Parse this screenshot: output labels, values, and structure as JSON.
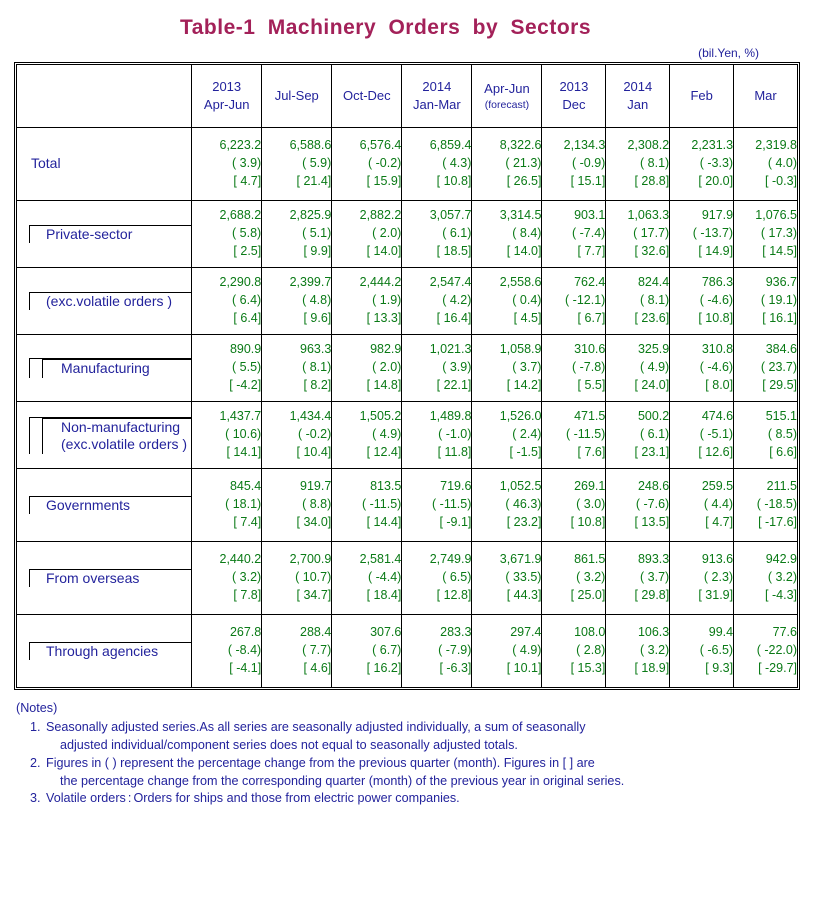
{
  "title": "Table-1  Machinery  Orders  by  Sectors",
  "unit_note": "(bil.Yen, %)",
  "columns": [
    {
      "year": "2013",
      "period": "Apr-Jun",
      "forecast": ""
    },
    {
      "year": "",
      "period": "Jul-Sep",
      "forecast": ""
    },
    {
      "year": "",
      "period": "Oct-Dec",
      "forecast": ""
    },
    {
      "year": "2014",
      "period": "Jan-Mar",
      "forecast": ""
    },
    {
      "year": "",
      "period": "Apr-Jun",
      "forecast": "(forecast)"
    },
    {
      "year": "2013",
      "period": "Dec",
      "forecast": ""
    },
    {
      "year": "2014",
      "period": "Jan",
      "forecast": ""
    },
    {
      "year": "",
      "period": "Feb",
      "forecast": ""
    },
    {
      "year": "",
      "period": "Mar",
      "forecast": ""
    }
  ],
  "rows": [
    {
      "id": "total",
      "label": "Total",
      "label2": "",
      "level": 0,
      "values": [
        [
          "6,223.2",
          "( 3.9)",
          "[ 4.7]"
        ],
        [
          "6,588.6",
          "( 5.9)",
          "[ 21.4]"
        ],
        [
          "6,576.4",
          "( -0.2)",
          "[ 15.9]"
        ],
        [
          "6,859.4",
          "( 4.3)",
          "[ 10.8]"
        ],
        [
          "8,322.6",
          "( 21.3)",
          "[ 26.5]"
        ],
        [
          "2,134.3",
          "( -0.9)",
          "[ 15.1]"
        ],
        [
          "2,308.2",
          "( 8.1)",
          "[ 28.8]"
        ],
        [
          "2,231.3",
          "( -3.3)",
          "[ 20.0]"
        ],
        [
          "2,319.8",
          "( 4.0)",
          "[ -0.3]"
        ]
      ]
    },
    {
      "id": "private-sector",
      "label": "Private-sector",
      "label2": "",
      "level": 1,
      "values": [
        [
          "2,688.2",
          "( 5.8)",
          "[ 2.5]"
        ],
        [
          "2,825.9",
          "( 5.1)",
          "[ 9.9]"
        ],
        [
          "2,882.2",
          "( 2.0)",
          "[ 14.0]"
        ],
        [
          "3,057.7",
          "( 6.1)",
          "[ 18.5]"
        ],
        [
          "3,314.5",
          "( 8.4)",
          "[ 14.0]"
        ],
        [
          "903.1",
          "( -7.4)",
          "[ 7.7]"
        ],
        [
          "1,063.3",
          "( 17.7)",
          "[ 32.6]"
        ],
        [
          "917.9",
          "( -13.7)",
          "[ 14.9]"
        ],
        [
          "1,076.5",
          "( 17.3)",
          "[ 14.5]"
        ]
      ]
    },
    {
      "id": "private-sector-exc-volatile",
      "label": "(exc.volatile orders )",
      "label2": "",
      "level": 1,
      "values": [
        [
          "2,290.8",
          "( 6.4)",
          "[ 6.4]"
        ],
        [
          "2,399.7",
          "( 4.8)",
          "[ 9.6]"
        ],
        [
          "2,444.2",
          "( 1.9)",
          "[ 13.3]"
        ],
        [
          "2,547.4",
          "( 4.2)",
          "[ 16.4]"
        ],
        [
          "2,558.6",
          "( 0.4)",
          "[ 4.5]"
        ],
        [
          "762.4",
          "( -12.1)",
          "[ 6.7]"
        ],
        [
          "824.4",
          "( 8.1)",
          "[ 23.6]"
        ],
        [
          "786.3",
          "( -4.6)",
          "[ 10.8]"
        ],
        [
          "936.7",
          "( 19.1)",
          "[ 16.1]"
        ]
      ]
    },
    {
      "id": "manufacturing",
      "label": "Manufacturing",
      "label2": "",
      "level": 2,
      "values": [
        [
          "890.9",
          "( 5.5)",
          "[ -4.2]"
        ],
        [
          "963.3",
          "( 8.1)",
          "[ 8.2]"
        ],
        [
          "982.9",
          "( 2.0)",
          "[ 14.8]"
        ],
        [
          "1,021.3",
          "( 3.9)",
          "[ 22.1]"
        ],
        [
          "1,058.9",
          "( 3.7)",
          "[ 14.2]"
        ],
        [
          "310.6",
          "( -7.8)",
          "[ 5.5]"
        ],
        [
          "325.9",
          "( 4.9)",
          "[ 24.0]"
        ],
        [
          "310.8",
          "( -4.6)",
          "[ 8.0]"
        ],
        [
          "384.6",
          "( 23.7)",
          "[ 29.5]"
        ]
      ]
    },
    {
      "id": "non-manufacturing",
      "label": "Non-manufacturing",
      "label2": "(exc.volatile orders )",
      "level": 2,
      "values": [
        [
          "1,437.7",
          "( 10.6)",
          "[ 14.1]"
        ],
        [
          "1,434.4",
          "( -0.2)",
          "[ 10.4]"
        ],
        [
          "1,505.2",
          "( 4.9)",
          "[ 12.4]"
        ],
        [
          "1,489.8",
          "( -1.0)",
          "[ 11.8]"
        ],
        [
          "1,526.0",
          "( 2.4)",
          "[ -1.5]"
        ],
        [
          "471.5",
          "( -11.5)",
          "[ 7.6]"
        ],
        [
          "500.2",
          "( 6.1)",
          "[ 23.1]"
        ],
        [
          "474.6",
          "( -5.1)",
          "[ 12.6]"
        ],
        [
          "515.1",
          "( 8.5)",
          "[ 6.6]"
        ]
      ]
    },
    {
      "id": "governments",
      "label": "Governments",
      "label2": "",
      "level": 1,
      "values": [
        [
          "845.4",
          "( 18.1)",
          "[ 7.4]"
        ],
        [
          "919.7",
          "( 8.8)",
          "[ 34.0]"
        ],
        [
          "813.5",
          "( -11.5)",
          "[ 14.4]"
        ],
        [
          "719.6",
          "( -11.5)",
          "[ -9.1]"
        ],
        [
          "1,052.5",
          "( 46.3)",
          "[ 23.2]"
        ],
        [
          "269.1",
          "( 3.0)",
          "[ 10.8]"
        ],
        [
          "248.6",
          "( -7.6)",
          "[ 13.5]"
        ],
        [
          "259.5",
          "( 4.4)",
          "[ 4.7]"
        ],
        [
          "211.5",
          "( -18.5)",
          "[ -17.6]"
        ]
      ]
    },
    {
      "id": "from-overseas",
      "label": "From overseas",
      "label2": "",
      "level": 1,
      "values": [
        [
          "2,440.2",
          "( 3.2)",
          "[ 7.8]"
        ],
        [
          "2,700.9",
          "( 10.7)",
          "[ 34.7]"
        ],
        [
          "2,581.4",
          "( -4.4)",
          "[ 18.4]"
        ],
        [
          "2,749.9",
          "( 6.5)",
          "[ 12.8]"
        ],
        [
          "3,671.9",
          "( 33.5)",
          "[ 44.3]"
        ],
        [
          "861.5",
          "( 3.2)",
          "[ 25.0]"
        ],
        [
          "893.3",
          "( 3.7)",
          "[ 29.8]"
        ],
        [
          "913.6",
          "( 2.3)",
          "[ 31.9]"
        ],
        [
          "942.9",
          "( 3.2)",
          "[ -4.3]"
        ]
      ]
    },
    {
      "id": "through-agencies",
      "label": "Through agencies",
      "label2": "",
      "level": 1,
      "values": [
        [
          "267.8",
          "( -8.4)",
          "[ -4.1]"
        ],
        [
          "288.4",
          "( 7.7)",
          "[ 4.6]"
        ],
        [
          "307.6",
          "( 6.7)",
          "[ 16.2]"
        ],
        [
          "283.3",
          "( -7.9)",
          "[ -6.3]"
        ],
        [
          "297.4",
          "( 4.9)",
          "[ 10.1]"
        ],
        [
          "108.0",
          "( 2.8)",
          "[ 15.3]"
        ],
        [
          "106.3",
          "( 3.2)",
          "[ 18.9]"
        ],
        [
          "99.4",
          "( -6.5)",
          "[ 9.3]"
        ],
        [
          "77.6",
          "( -22.0)",
          "[ -29.7]"
        ]
      ]
    }
  ],
  "notes": {
    "heading": "(Notes)",
    "items": [
      {
        "num": "1.",
        "line1": "Seasonally adjusted series.As all series are seasonally adjusted individually, a sum of seasonally",
        "line2": "adjusted individual/component series does not equal to seasonally adjusted totals."
      },
      {
        "num": "2.",
        "line1": "Figures in ( ) represent the percentage change from the previous quarter (month). Figures in [ ] are",
        "line2": "the percentage change from the corresponding quarter (month) of the previous year in original series."
      },
      {
        "num": "3.",
        "line1": "Volatile orders : Orders for ships and those from electric power companies.",
        "line2": ""
      }
    ]
  },
  "colors": {
    "title": "#a32159",
    "label_text": "#23239c",
    "number_text": "#0a7a16",
    "border": "#000000"
  }
}
